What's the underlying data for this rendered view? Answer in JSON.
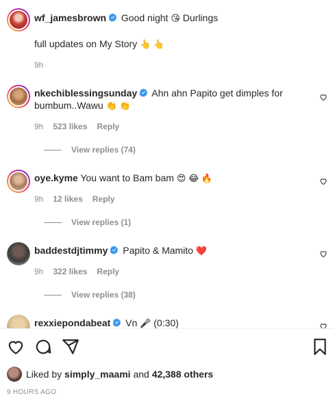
{
  "caption": {
    "username": "wf_jamesbrown",
    "text": "Good night",
    "emoji1": "😘",
    "text2": "Durlings",
    "line2": "full updates on My Story",
    "emoji2": "👆 👆",
    "time": "9h"
  },
  "comments": [
    {
      "username": "nkechiblessingsunday",
      "text": "Ahn ahn Papito get dimples for bumbum..Wawu",
      "emoji": "👏 👏",
      "time": "9h",
      "likes": "523 likes",
      "reply_label": "Reply",
      "view_replies": "View replies (74)"
    },
    {
      "username": "oye.kyme",
      "text": "You want to Bam bam",
      "emoji": "😍 😂 🔥",
      "time": "9h",
      "likes": "12 likes",
      "reply_label": "Reply",
      "view_replies": "View replies (1)"
    },
    {
      "username": "baddestdjtimmy",
      "text": "Papito & Mamito",
      "emoji": "❤️",
      "time": "9h",
      "likes": "322 likes",
      "reply_label": "Reply",
      "view_replies": "View replies (38)"
    },
    {
      "username": "rexxiepondabeat",
      "text": "Vn",
      "emoji": "🎤",
      "extra": "(0:30)"
    }
  ],
  "likes": {
    "prefix": "Liked by",
    "user": "simply_maami",
    "and": "and",
    "others": "42,388 others"
  },
  "timestamp": "9 HOURS AGO",
  "icons": {
    "like": "heart-icon",
    "comment": "comment-icon",
    "share": "share-icon",
    "save": "bookmark-icon",
    "verified": "verified-badge-icon"
  },
  "colors": {
    "verified": "#3897f0",
    "muted": "#8e8e8e",
    "text": "#262626"
  }
}
